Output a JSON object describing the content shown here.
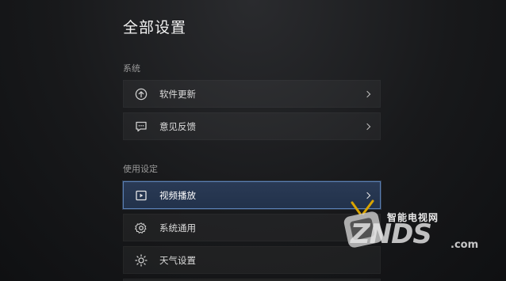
{
  "page": {
    "title": "全部设置"
  },
  "sections": [
    {
      "label": "系统",
      "items": [
        {
          "label": "软件更新",
          "icon": "upload-arrow-circle-icon"
        },
        {
          "label": "意见反馈",
          "icon": "chat-bubble-icon"
        }
      ]
    },
    {
      "label": "使用设定",
      "items": [
        {
          "label": "视频播放",
          "icon": "play-screen-icon",
          "selected": true
        },
        {
          "label": "系统通用",
          "icon": "gear-icon"
        },
        {
          "label": "天气设置",
          "icon": "sun-icon"
        }
      ]
    }
  ],
  "watermark": {
    "top": "智能电视网",
    "main": "ZNDS",
    "domain": ".com"
  },
  "colors": {
    "accent_border": "#5a7fb3",
    "selected_bg": "#26364f"
  }
}
